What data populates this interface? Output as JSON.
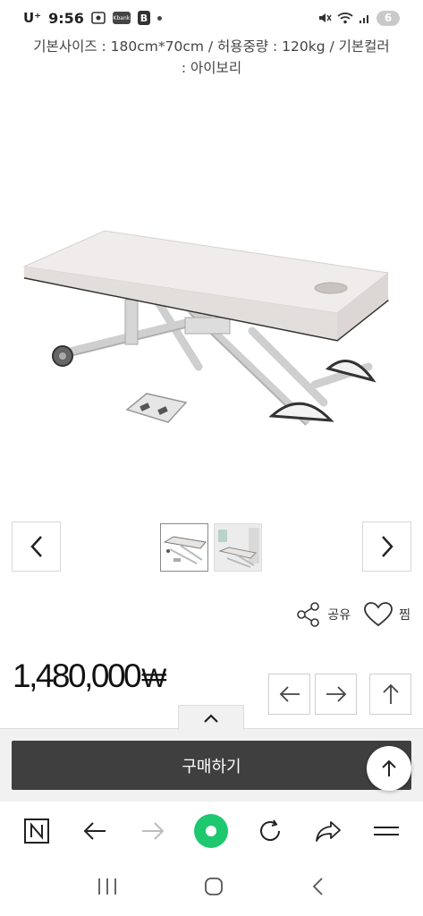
{
  "status": {
    "carrier": "U⁺",
    "time": "9:56",
    "kbank_label": "Kbank",
    "b_label": "B",
    "battery": "6",
    "icons": [
      "screenshot-icon",
      "kbank-icon",
      "b-app-icon",
      "dot-icon",
      "mute-icon",
      "wifi-icon",
      "signal-icon",
      "battery-icon"
    ]
  },
  "product": {
    "spec_line1": "기본사이즈 : 180cm*70cm / 허용중량 : 120kg / 기본컬러",
    "spec_line2": ": 아이보리",
    "price": "1,480,000",
    "currency": "₩"
  },
  "actions": {
    "share_label": "공유",
    "like_label": "찜"
  },
  "buy": {
    "button_label": "구매하기"
  },
  "colors": {
    "buy_button": "#3f3f3f",
    "active_green": "#1ec86e",
    "panel_bg": "#f1f1f1"
  }
}
